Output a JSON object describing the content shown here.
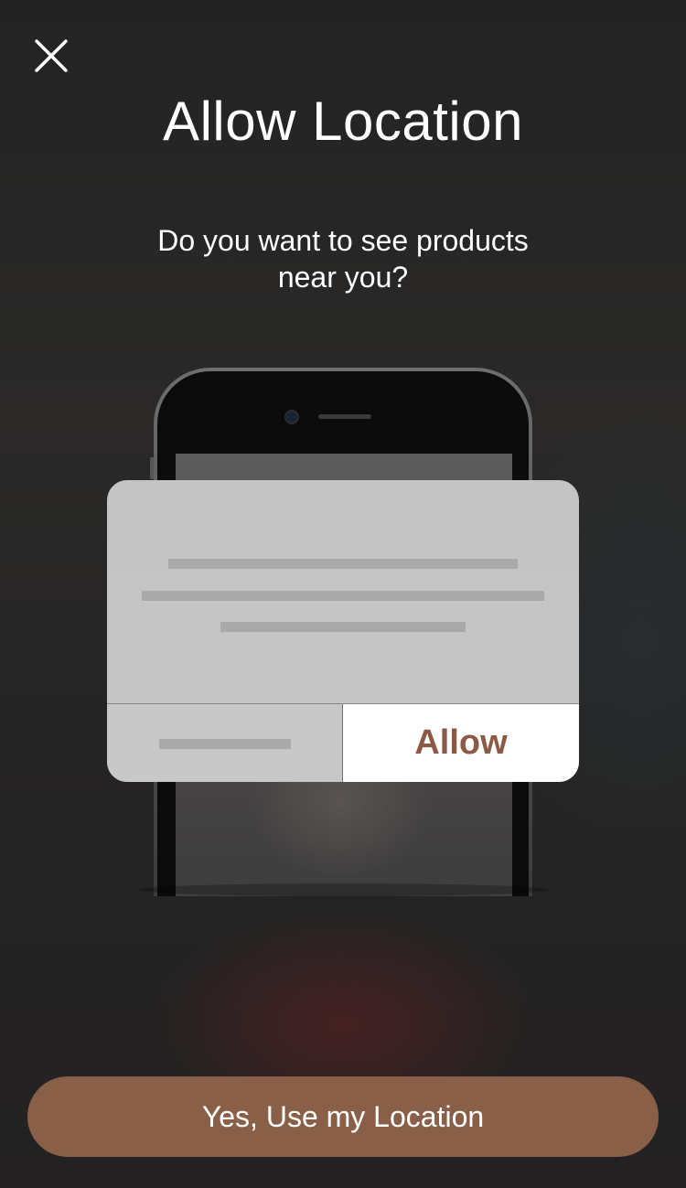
{
  "header": {
    "close_icon": "close-icon",
    "title": "Allow Location"
  },
  "subtitle": "Do you want to see products near you?",
  "illustration": {
    "dialog_button_label": "Allow",
    "accent_color": "#8b5a45"
  },
  "cta": {
    "label": "Yes, Use my Location",
    "color": "#8a5f48"
  }
}
